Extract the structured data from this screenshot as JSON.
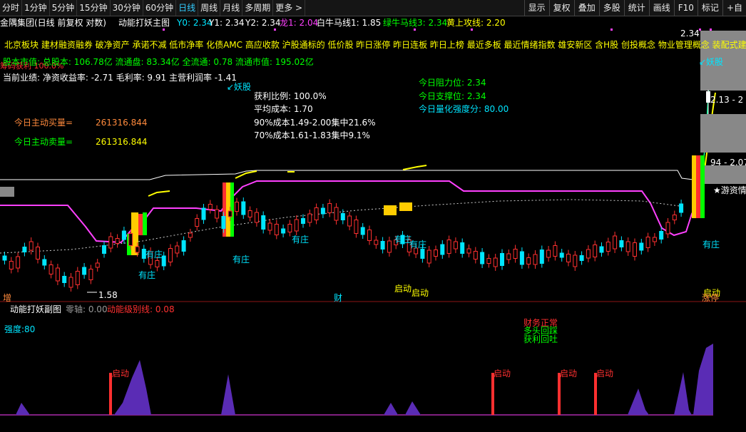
{
  "toolbar": {
    "periods": [
      "分时",
      "1分钟",
      "5分钟",
      "15分钟",
      "30分钟",
      "60分钟",
      "日线",
      "周线",
      "月线",
      "多周期",
      "更多 >"
    ],
    "active": "日线",
    "right_buttons": [
      "显示",
      "复权",
      "叠加",
      "多股",
      "统计",
      "画线",
      "F10",
      "标记",
      "+自"
    ]
  },
  "title_row": {
    "stock": "金隅集团(日线 前复权 对数)",
    "indicator": "动能打妖主图",
    "y0": "Y0: 2.34",
    "y1": "Y1: 2.34",
    "y2": "Y2: 2.34",
    "long1": "龙1: 2.04",
    "bull": "白牛马线1: 1.85",
    "green_line": "绿牛马线3: 2.34",
    "yellow_line": "黄上攻线: 2.20"
  },
  "concepts": "北京板块  建材融资融券 破净资产 承诺不减 低市净率 化债AMC 高应收款 沪股通标的 低价股 昨日涨停 昨日连板 昨日上榜 最近多板 最近情绪指数  雄安新区 含H股 创投概念 物业管理概念 装配式建筑",
  "flow_label": "筹码获利 100.0%",
  "capital": "股本市值: 总股本: 106.78亿 流通盘: 83.34亿 全流通: 0.78 流通市值: 195.02亿",
  "performance": "当前业绩:  净资收益率: -2.71 毛利率: 9.91 主营利润率 -1.41",
  "yao_label": "↙妖股",
  "chip": {
    "profit_ratio": "获利比例: 100.0%",
    "avg_cost": "平均成本: 1.70",
    "cost90": "90%成本1.49-2.00集中21.6%",
    "cost70": "70%成本1.61-1.83集中9.1%"
  },
  "levels": {
    "resist": "今日阻力位:  2.34",
    "support": "今日支撑位:  2.34",
    "strength": "今日量化强度分:  80.00"
  },
  "active_buy": {
    "label": "今日主动买量=",
    "value": "261316.844"
  },
  "active_sell": {
    "label": "今日主动卖量=",
    "value": "261316.844"
  },
  "price_labels": {
    "top": "2.34",
    "low": "1.58",
    "right1": "2.13 - 2",
    "right2": "94 - 2.07"
  },
  "chart_marks": {
    "youzhuang": "有庄",
    "qidong": "启动",
    "yaogu": "↙妖股",
    "youzi": "★游资情",
    "zeng": "增",
    "cai": "财",
    "zhangting": "涨停"
  },
  "sub": {
    "title": "动能打妖副图",
    "zero": "零轴: 0.00",
    "level_line": "动能级别线: 0.08",
    "strength": "强度:80",
    "signal1": "财务正常",
    "signal2": "多头回踩",
    "signal3": "获利回吐",
    "start": "启动"
  },
  "colors": {
    "bg": "#000000",
    "up": "#ff3030",
    "down": "#00e5ff",
    "yellow": "#ffff00",
    "magenta": "#ff40ff"
  }
}
